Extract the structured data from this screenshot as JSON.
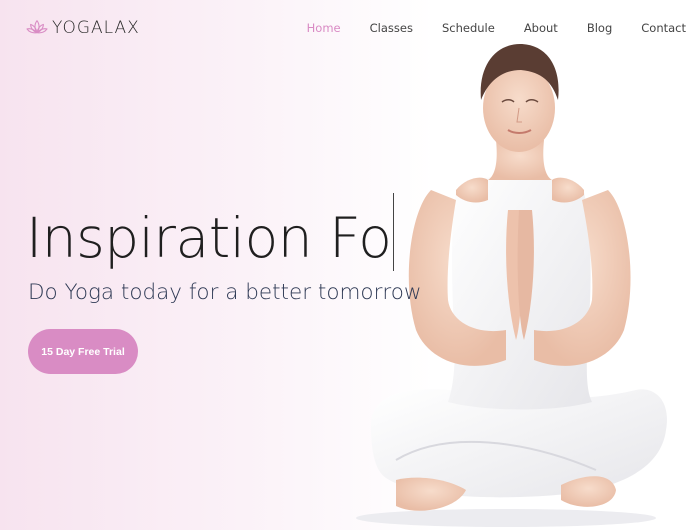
{
  "brand": {
    "name": "YOGALAX",
    "accent_color": "#d98cc4"
  },
  "nav": {
    "items": [
      {
        "label": "Home",
        "active": true
      },
      {
        "label": "Classes",
        "active": false
      },
      {
        "label": "Schedule",
        "active": false
      },
      {
        "label": "About",
        "active": false
      },
      {
        "label": "Blog",
        "active": false
      },
      {
        "label": "Contact",
        "active": false
      }
    ]
  },
  "hero": {
    "title": "Inspiration Fo",
    "subtitle": "Do Yoga today for a better tomorrow",
    "cta_label": "15 Day Free Trial"
  },
  "icons": {
    "logo": "lotus-icon"
  }
}
